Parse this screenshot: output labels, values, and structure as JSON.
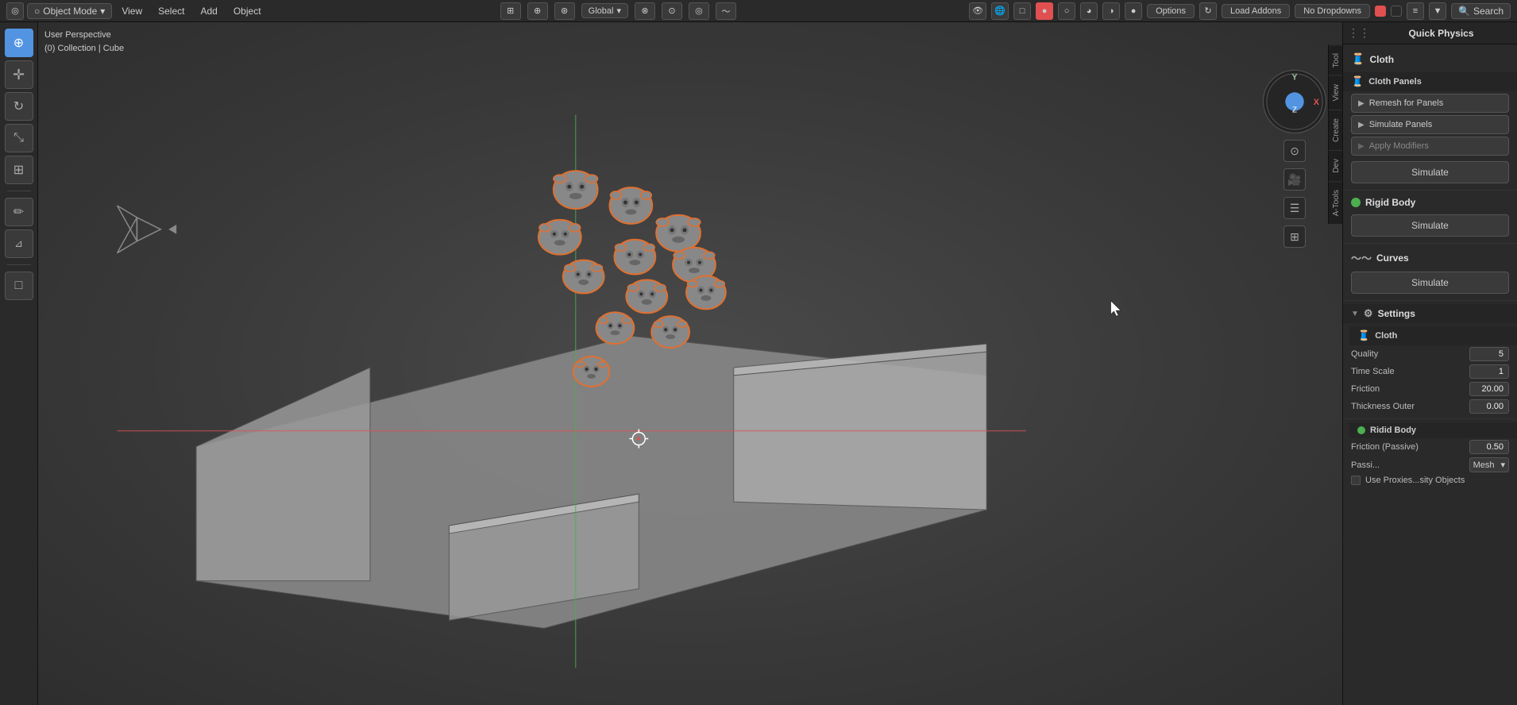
{
  "topbar": {
    "mode": "Object Mode",
    "menus": [
      "View",
      "Select",
      "Add",
      "Object"
    ],
    "transform": "Global",
    "options_label": "Options",
    "load_addons_label": "Load Addons",
    "no_dropdowns": "No Dropdowns",
    "search_label": "Search"
  },
  "viewport": {
    "label_line1": "User Perspective",
    "label_line2": "(0) Collection | Cube",
    "gizmo": {
      "x": "X",
      "y": "Y",
      "z": "Z"
    }
  },
  "right_panel": {
    "title": "Quick Physics",
    "sections": {
      "cloth": {
        "label": "Cloth",
        "panels_label": "Cloth Panels",
        "buttons": [
          "Remesh for Panels",
          "Simulate Panels",
          "Apply Modifiers"
        ],
        "simulate_label": "Simulate"
      },
      "rigid_body": {
        "label": "Rigid Body",
        "simulate_label": "Simulate"
      },
      "curves": {
        "label": "Curves",
        "simulate_label": "Simulate"
      },
      "settings": {
        "label": "Settings",
        "cloth_subsection": {
          "label": "Cloth",
          "quality_label": "Quality",
          "quality_value": "5",
          "time_scale_label": "Time Scale",
          "time_scale_value": "1",
          "friction_label": "Friction",
          "friction_value": "20.00",
          "thickness_outer_label": "Thickness Outer",
          "thickness_outer_value": "0.00"
        },
        "rigid_body_subsection": {
          "label": "Ridid Body",
          "friction_passive_label": "Friction (Passive)",
          "friction_passive_value": "0.50",
          "passive_mesh_label": "Passi...",
          "passive_mesh_value": "Mesh",
          "use_proxies_label": "Use Proxies...sity Objects"
        }
      }
    }
  },
  "vtabs": [
    "Tool",
    "View",
    "Create",
    "Dev",
    "A-Tools"
  ],
  "icons": {
    "cursor": "⊕",
    "move": "✥",
    "rotate": "↻",
    "scale": "⤡",
    "transform": "⊞",
    "annotate": "✏",
    "measure": "📐",
    "add_cube": "□",
    "cloth_icon": "🧵",
    "settings_icon": "⚙",
    "play_icon": "▶",
    "dot_green": "●",
    "dot_orange": "●",
    "collapse_arrow": "▼",
    "expand_arrow": "▶"
  }
}
